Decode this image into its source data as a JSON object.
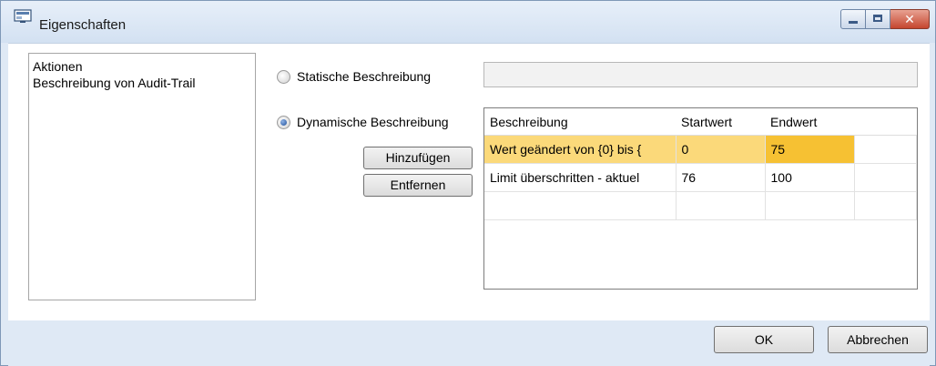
{
  "window": {
    "title": "Eigenschaften",
    "close_glyph": "✕"
  },
  "left_panel": {
    "items": [
      "Aktionen",
      "Beschreibung von Audit-Trail"
    ]
  },
  "options": {
    "static_label": "Statische Beschreibung",
    "static_value": "",
    "dynamic_label": "Dynamische Beschreibung",
    "selected": "dynamic"
  },
  "buttons": {
    "add": "Hinzufügen",
    "remove": "Entfernen",
    "ok": "OK",
    "cancel": "Abbrechen"
  },
  "grid": {
    "headers": [
      "Beschreibung",
      "Startwert",
      "Endwert",
      ""
    ],
    "rows": [
      [
        "Wert geändert von {0} bis {",
        "0",
        "75",
        ""
      ],
      [
        "Limit überschritten - aktuel",
        "76",
        "100",
        ""
      ],
      [
        "",
        "",
        "",
        ""
      ]
    ]
  },
  "colors": {
    "selection": "#fbd97a",
    "selection_cell": "#f6c133",
    "close_button": "#c5462f"
  },
  "icons": {
    "app": "window-icon"
  }
}
